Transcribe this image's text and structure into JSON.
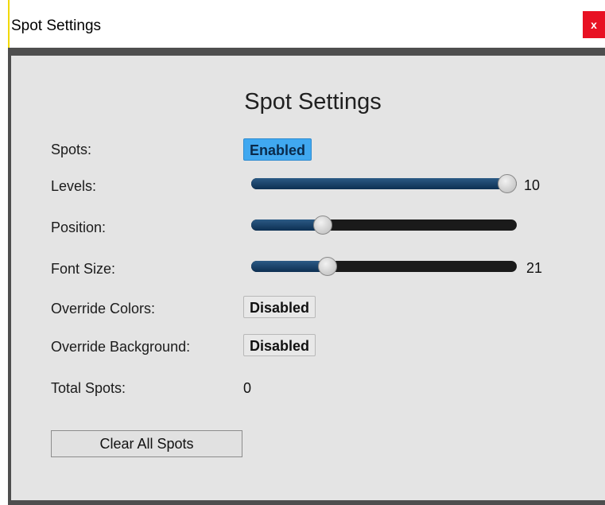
{
  "window": {
    "title": "Spot Settings",
    "close_label": "x"
  },
  "panel": {
    "heading": "Spot Settings"
  },
  "settings": {
    "spots": {
      "label": "Spots:",
      "value": "Enabled"
    },
    "levels": {
      "label": "Levels:",
      "value_text": "10",
      "level": 1.0
    },
    "position": {
      "label": "Position:",
      "level": 0.25
    },
    "font_size": {
      "label": "Font Size:",
      "value_text": "21",
      "level": 0.27
    },
    "override_colors": {
      "label": "Override Colors:",
      "value": "Disabled"
    },
    "override_background": {
      "label": "Override Background:",
      "value": "Disabled"
    },
    "total_spots": {
      "label": "Total Spots:",
      "value": "0"
    }
  },
  "actions": {
    "clear_all": "Clear All Spots"
  },
  "colors": {
    "enabled_accent": "#40a8f0",
    "close_button": "#e81123",
    "title_accent": "#f2d900"
  }
}
